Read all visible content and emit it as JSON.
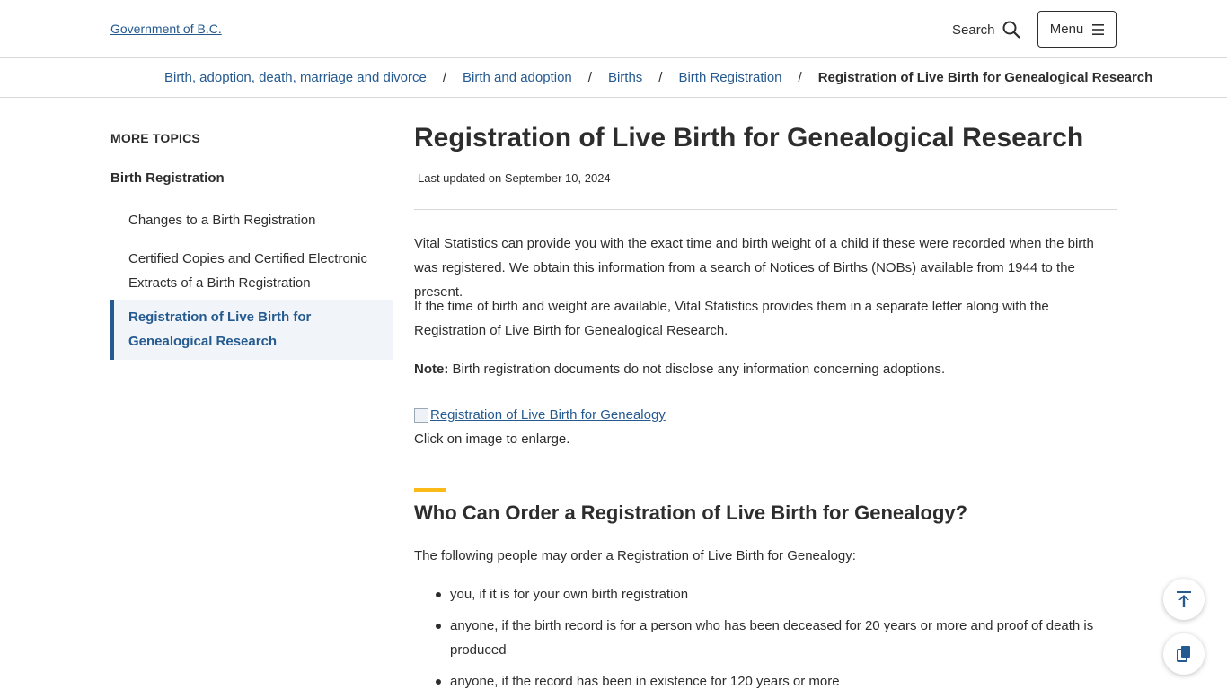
{
  "header": {
    "logo_alt": "Government of B.C.",
    "search_label": "Search",
    "menu_label": "Menu"
  },
  "breadcrumb": {
    "items": [
      "Birth, adoption, death, marriage and divorce",
      "Birth and adoption",
      "Births",
      "Birth Registration"
    ],
    "current": "Registration of Live Birth for Genealogical Research",
    "separator": "/"
  },
  "sidebar": {
    "more_topics": "MORE TOPICS",
    "heading": "Birth Registration",
    "items": [
      {
        "label": "Changes to a Birth Registration"
      },
      {
        "label": "Certified Copies and Certified Electronic Extracts of a Birth Registration"
      },
      {
        "label": "Registration of Live Birth for Genealogical Research",
        "active": true
      }
    ]
  },
  "main": {
    "title": "Registration of Live Birth for Genealogical Research",
    "updated": "Last updated on September 10, 2024",
    "para1": "Vital Statistics can provide you with the exact time and birth weight of a child if these were recorded when the birth was registered. We obtain this information from a search of Notices of Births (NOBs) available from 1944 to the present.",
    "para2": "If the time of birth and weight are available, Vital Statistics provides them in a separate letter along with the Registration of Live Birth for Genealogical Research.",
    "note_label": "Note:",
    "note_text": " Birth registration documents do not disclose any information concerning adoptions.",
    "image_alt": "Registration of Live Birth for Genealogy",
    "image_caption": "Click on image to enlarge.",
    "section_heading": "Who Can Order a Registration of Live Birth for Genealogy?",
    "section_intro": "The following people may order a Registration of Live Birth for Genealogy:",
    "bullets": [
      "you, if it is for your own birth registration",
      "anyone, if the birth record is for a person who has been deceased for 20 years or more and proof of death is produced",
      "anyone, if the record has been in existence for 120 years or more"
    ]
  },
  "colors": {
    "link": "#255a90",
    "accent": "#fcba19",
    "text": "#2d2d2d",
    "active_bg": "#f1f5f9"
  },
  "icons": {
    "search": "magnifier-icon",
    "menu": "hamburger-icon",
    "back_to_top": "arrow-up-to-top-icon",
    "copy": "copy-icon"
  }
}
